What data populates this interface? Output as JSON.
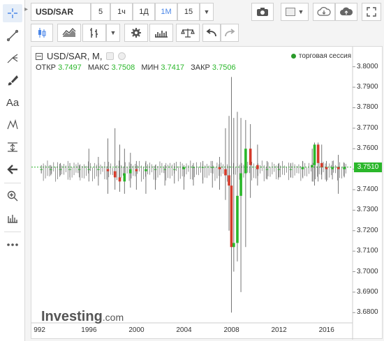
{
  "symbol": "USD/SAR",
  "intervals": [
    {
      "label": "5",
      "active": false
    },
    {
      "label": "1ч",
      "active": false
    },
    {
      "label": "1Д",
      "active": false
    },
    {
      "label": "1М",
      "active": true
    },
    {
      "label": "15",
      "active": false
    }
  ],
  "legend": {
    "title": "USD/SAR, M,",
    "open_label": "ОТКР",
    "open": "3.7497",
    "high_label": "МАКС",
    "high": "3.7508",
    "low_label": "МИН",
    "low": "3.7417",
    "close_label": "ЗАКР",
    "close": "3.7506",
    "session": "торговая сессия"
  },
  "watermark": {
    "brand": "Investing",
    "suffix": ".com"
  },
  "colors": {
    "up": "#2ab72a",
    "down": "#d43a2a",
    "accent": "#4a86e8",
    "wick": "#666666"
  },
  "chart_data": {
    "type": "candlestick",
    "y_ticks": [
      "3.8000",
      "3.7900",
      "3.7800",
      "3.7700",
      "3.7600",
      "3.7500",
      "3.7400",
      "3.7300",
      "3.7200",
      "3.7100",
      "3.7000",
      "3.6900",
      "3.6800"
    ],
    "x_ticks": [
      "992",
      "1996",
      "2000",
      "2004",
      "2008",
      "2012",
      "2016"
    ],
    "ylim": [
      3.675,
      3.805
    ],
    "current_price": "3.7510",
    "current_value": 3.751,
    "x": [
      1992.0,
      1992.8,
      1993.6,
      1994.4,
      1995.2,
      1996.0,
      1996.8,
      1997.6,
      1998.2,
      1998.6,
      1999.0,
      1999.5,
      2000.0,
      2000.8,
      2001.6,
      2002.4,
      2003.2,
      2004.0,
      2004.8,
      2005.6,
      2006.4,
      2007.0,
      2007.5,
      2007.8,
      2008.0,
      2008.2,
      2008.5,
      2008.8,
      2009.2,
      2009.6,
      2010.2,
      2011.0,
      2012.0,
      2013.0,
      2014.0,
      2014.8,
      2015.0,
      2015.3,
      2015.6,
      2016.0,
      2016.5,
      2017.0,
      2017.5
    ],
    "open": [
      3.75,
      3.75,
      3.75,
      3.75,
      3.75,
      3.75,
      3.75,
      3.75,
      3.749,
      3.746,
      3.744,
      3.748,
      3.75,
      3.749,
      3.75,
      3.75,
      3.75,
      3.75,
      3.751,
      3.751,
      3.751,
      3.751,
      3.75,
      3.747,
      3.742,
      3.712,
      3.714,
      3.737,
      3.748,
      3.76,
      3.752,
      3.75,
      3.75,
      3.75,
      3.75,
      3.751,
      3.752,
      3.762,
      3.753,
      3.751,
      3.75,
      3.751,
      3.75
    ],
    "high": [
      3.752,
      3.752,
      3.753,
      3.753,
      3.752,
      3.76,
      3.756,
      3.765,
      3.77,
      3.762,
      3.76,
      3.758,
      3.754,
      3.754,
      3.752,
      3.752,
      3.753,
      3.752,
      3.753,
      3.754,
      3.754,
      3.756,
      3.77,
      3.776,
      3.795,
      3.775,
      3.778,
      3.775,
      3.774,
      3.772,
      3.762,
      3.754,
      3.753,
      3.753,
      3.754,
      3.76,
      3.763,
      3.763,
      3.762,
      3.754,
      3.754,
      3.757,
      3.753
    ],
    "low": [
      3.748,
      3.747,
      3.747,
      3.746,
      3.746,
      3.744,
      3.742,
      3.738,
      3.74,
      3.739,
      3.738,
      3.741,
      3.74,
      3.738,
      3.74,
      3.742,
      3.743,
      3.74,
      3.742,
      3.743,
      3.741,
      3.74,
      3.735,
      3.72,
      3.68,
      3.7,
      3.705,
      3.69,
      3.712,
      3.736,
      3.742,
      3.745,
      3.746,
      3.746,
      3.746,
      3.744,
      3.742,
      3.744,
      3.745,
      3.744,
      3.745,
      3.738,
      3.746
    ],
    "close": [
      3.75,
      3.75,
      3.75,
      3.75,
      3.75,
      3.75,
      3.75,
      3.749,
      3.746,
      3.744,
      3.748,
      3.75,
      3.749,
      3.75,
      3.75,
      3.75,
      3.75,
      3.751,
      3.751,
      3.751,
      3.751,
      3.75,
      3.747,
      3.742,
      3.712,
      3.714,
      3.737,
      3.748,
      3.76,
      3.752,
      3.75,
      3.75,
      3.75,
      3.75,
      3.751,
      3.752,
      3.762,
      3.753,
      3.751,
      3.75,
      3.751,
      3.75,
      3.751
    ]
  }
}
